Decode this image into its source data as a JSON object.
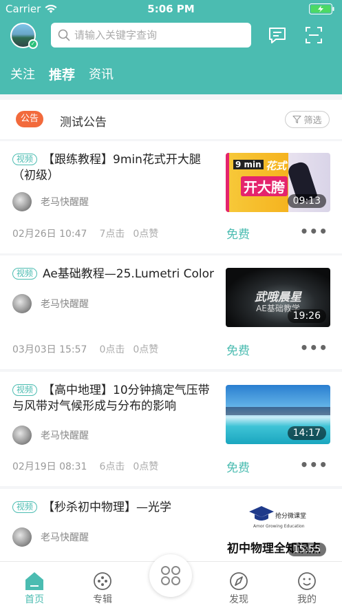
{
  "status_bar": {
    "carrier": "Carrier",
    "time": "5:06 PM"
  },
  "header": {
    "search_placeholder": "请输入关键字查询",
    "tabs": [
      {
        "label": "关注",
        "active": false
      },
      {
        "label": "推荐",
        "active": true
      },
      {
        "label": "资讯",
        "active": false
      }
    ]
  },
  "announcement": {
    "badge": "公告",
    "text": "测试公告",
    "filter_label": "筛选"
  },
  "feed": [
    {
      "tag": "视频",
      "title": "【跟练教程】9min花式开大腿（初级）",
      "author": "老马快醒醒",
      "date": "02月26日 10:47",
      "clicks": "7点击",
      "likes": "0点赞",
      "price": "免费",
      "duration": "09:13",
      "thumb_caption_1": "9 min",
      "thumb_caption_2": "花式",
      "thumb_caption_3": "开大胯"
    },
    {
      "tag": "视频",
      "title": "Ae基础教程—25.Lumetri Color",
      "author": "老马快醒醒",
      "date": "03月03日 15:57",
      "clicks": "0点击",
      "likes": "0点赞",
      "price": "免费",
      "duration": "19:26",
      "thumb_caption_1": "武哦晨星",
      "thumb_caption_2": "AE基础教学"
    },
    {
      "tag": "视频",
      "title": "【高中地理】10分钟搞定气压带与风带对气候形成与分布的影响",
      "author": "老马快醒醒",
      "date": "02月19日 08:31",
      "clicks": "6点击",
      "likes": "0点赞",
      "price": "免费",
      "duration": "14:17"
    },
    {
      "tag": "视频",
      "title": "【秒杀初中物理】—光学",
      "author": "老马快醒醒",
      "duration": "15:55",
      "thumb_brand": "抢分微课堂",
      "thumb_brand_en": "Amor Growing Education",
      "thumb_caption": "初中物理全知识点"
    }
  ],
  "bottom_nav": [
    {
      "label": "首页",
      "active": true
    },
    {
      "label": "专辑",
      "active": false
    },
    {
      "label": "发现",
      "active": false
    },
    {
      "label": "我的",
      "active": false
    }
  ],
  "colors": {
    "primary": "#4bbcb1",
    "announce_badge": "#f26a3c"
  }
}
